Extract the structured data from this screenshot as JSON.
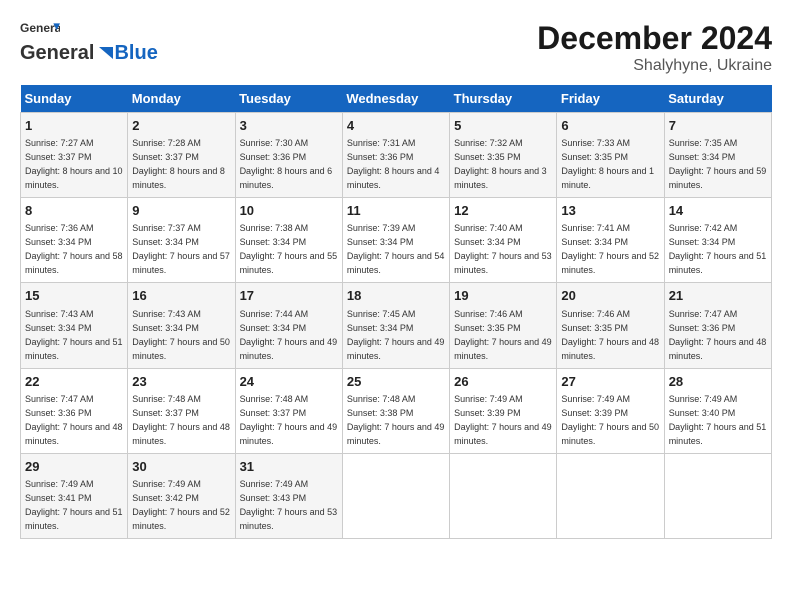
{
  "logo": {
    "general": "General",
    "blue": "Blue"
  },
  "header": {
    "month": "December 2024",
    "location": "Shalyhyne, Ukraine"
  },
  "weekdays": [
    "Sunday",
    "Monday",
    "Tuesday",
    "Wednesday",
    "Thursday",
    "Friday",
    "Saturday"
  ],
  "weeks": [
    [
      {
        "day": "1",
        "sunrise": "7:27 AM",
        "sunset": "3:37 PM",
        "daylight": "8 hours and 10 minutes."
      },
      {
        "day": "2",
        "sunrise": "7:28 AM",
        "sunset": "3:37 PM",
        "daylight": "8 hours and 8 minutes."
      },
      {
        "day": "3",
        "sunrise": "7:30 AM",
        "sunset": "3:36 PM",
        "daylight": "8 hours and 6 minutes."
      },
      {
        "day": "4",
        "sunrise": "7:31 AM",
        "sunset": "3:36 PM",
        "daylight": "8 hours and 4 minutes."
      },
      {
        "day": "5",
        "sunrise": "7:32 AM",
        "sunset": "3:35 PM",
        "daylight": "8 hours and 3 minutes."
      },
      {
        "day": "6",
        "sunrise": "7:33 AM",
        "sunset": "3:35 PM",
        "daylight": "8 hours and 1 minute."
      },
      {
        "day": "7",
        "sunrise": "7:35 AM",
        "sunset": "3:34 PM",
        "daylight": "7 hours and 59 minutes."
      }
    ],
    [
      {
        "day": "8",
        "sunrise": "7:36 AM",
        "sunset": "3:34 PM",
        "daylight": "7 hours and 58 minutes."
      },
      {
        "day": "9",
        "sunrise": "7:37 AM",
        "sunset": "3:34 PM",
        "daylight": "7 hours and 57 minutes."
      },
      {
        "day": "10",
        "sunrise": "7:38 AM",
        "sunset": "3:34 PM",
        "daylight": "7 hours and 55 minutes."
      },
      {
        "day": "11",
        "sunrise": "7:39 AM",
        "sunset": "3:34 PM",
        "daylight": "7 hours and 54 minutes."
      },
      {
        "day": "12",
        "sunrise": "7:40 AM",
        "sunset": "3:34 PM",
        "daylight": "7 hours and 53 minutes."
      },
      {
        "day": "13",
        "sunrise": "7:41 AM",
        "sunset": "3:34 PM",
        "daylight": "7 hours and 52 minutes."
      },
      {
        "day": "14",
        "sunrise": "7:42 AM",
        "sunset": "3:34 PM",
        "daylight": "7 hours and 51 minutes."
      }
    ],
    [
      {
        "day": "15",
        "sunrise": "7:43 AM",
        "sunset": "3:34 PM",
        "daylight": "7 hours and 51 minutes."
      },
      {
        "day": "16",
        "sunrise": "7:43 AM",
        "sunset": "3:34 PM",
        "daylight": "7 hours and 50 minutes."
      },
      {
        "day": "17",
        "sunrise": "7:44 AM",
        "sunset": "3:34 PM",
        "daylight": "7 hours and 49 minutes."
      },
      {
        "day": "18",
        "sunrise": "7:45 AM",
        "sunset": "3:34 PM",
        "daylight": "7 hours and 49 minutes."
      },
      {
        "day": "19",
        "sunrise": "7:46 AM",
        "sunset": "3:35 PM",
        "daylight": "7 hours and 49 minutes."
      },
      {
        "day": "20",
        "sunrise": "7:46 AM",
        "sunset": "3:35 PM",
        "daylight": "7 hours and 48 minutes."
      },
      {
        "day": "21",
        "sunrise": "7:47 AM",
        "sunset": "3:36 PM",
        "daylight": "7 hours and 48 minutes."
      }
    ],
    [
      {
        "day": "22",
        "sunrise": "7:47 AM",
        "sunset": "3:36 PM",
        "daylight": "7 hours and 48 minutes."
      },
      {
        "day": "23",
        "sunrise": "7:48 AM",
        "sunset": "3:37 PM",
        "daylight": "7 hours and 48 minutes."
      },
      {
        "day": "24",
        "sunrise": "7:48 AM",
        "sunset": "3:37 PM",
        "daylight": "7 hours and 49 minutes."
      },
      {
        "day": "25",
        "sunrise": "7:48 AM",
        "sunset": "3:38 PM",
        "daylight": "7 hours and 49 minutes."
      },
      {
        "day": "26",
        "sunrise": "7:49 AM",
        "sunset": "3:39 PM",
        "daylight": "7 hours and 49 minutes."
      },
      {
        "day": "27",
        "sunrise": "7:49 AM",
        "sunset": "3:39 PM",
        "daylight": "7 hours and 50 minutes."
      },
      {
        "day": "28",
        "sunrise": "7:49 AM",
        "sunset": "3:40 PM",
        "daylight": "7 hours and 51 minutes."
      }
    ],
    [
      {
        "day": "29",
        "sunrise": "7:49 AM",
        "sunset": "3:41 PM",
        "daylight": "7 hours and 51 minutes."
      },
      {
        "day": "30",
        "sunrise": "7:49 AM",
        "sunset": "3:42 PM",
        "daylight": "7 hours and 52 minutes."
      },
      {
        "day": "31",
        "sunrise": "7:49 AM",
        "sunset": "3:43 PM",
        "daylight": "7 hours and 53 minutes."
      },
      null,
      null,
      null,
      null
    ]
  ],
  "labels": {
    "sunrise": "Sunrise:",
    "sunset": "Sunset:",
    "daylight": "Daylight:"
  }
}
